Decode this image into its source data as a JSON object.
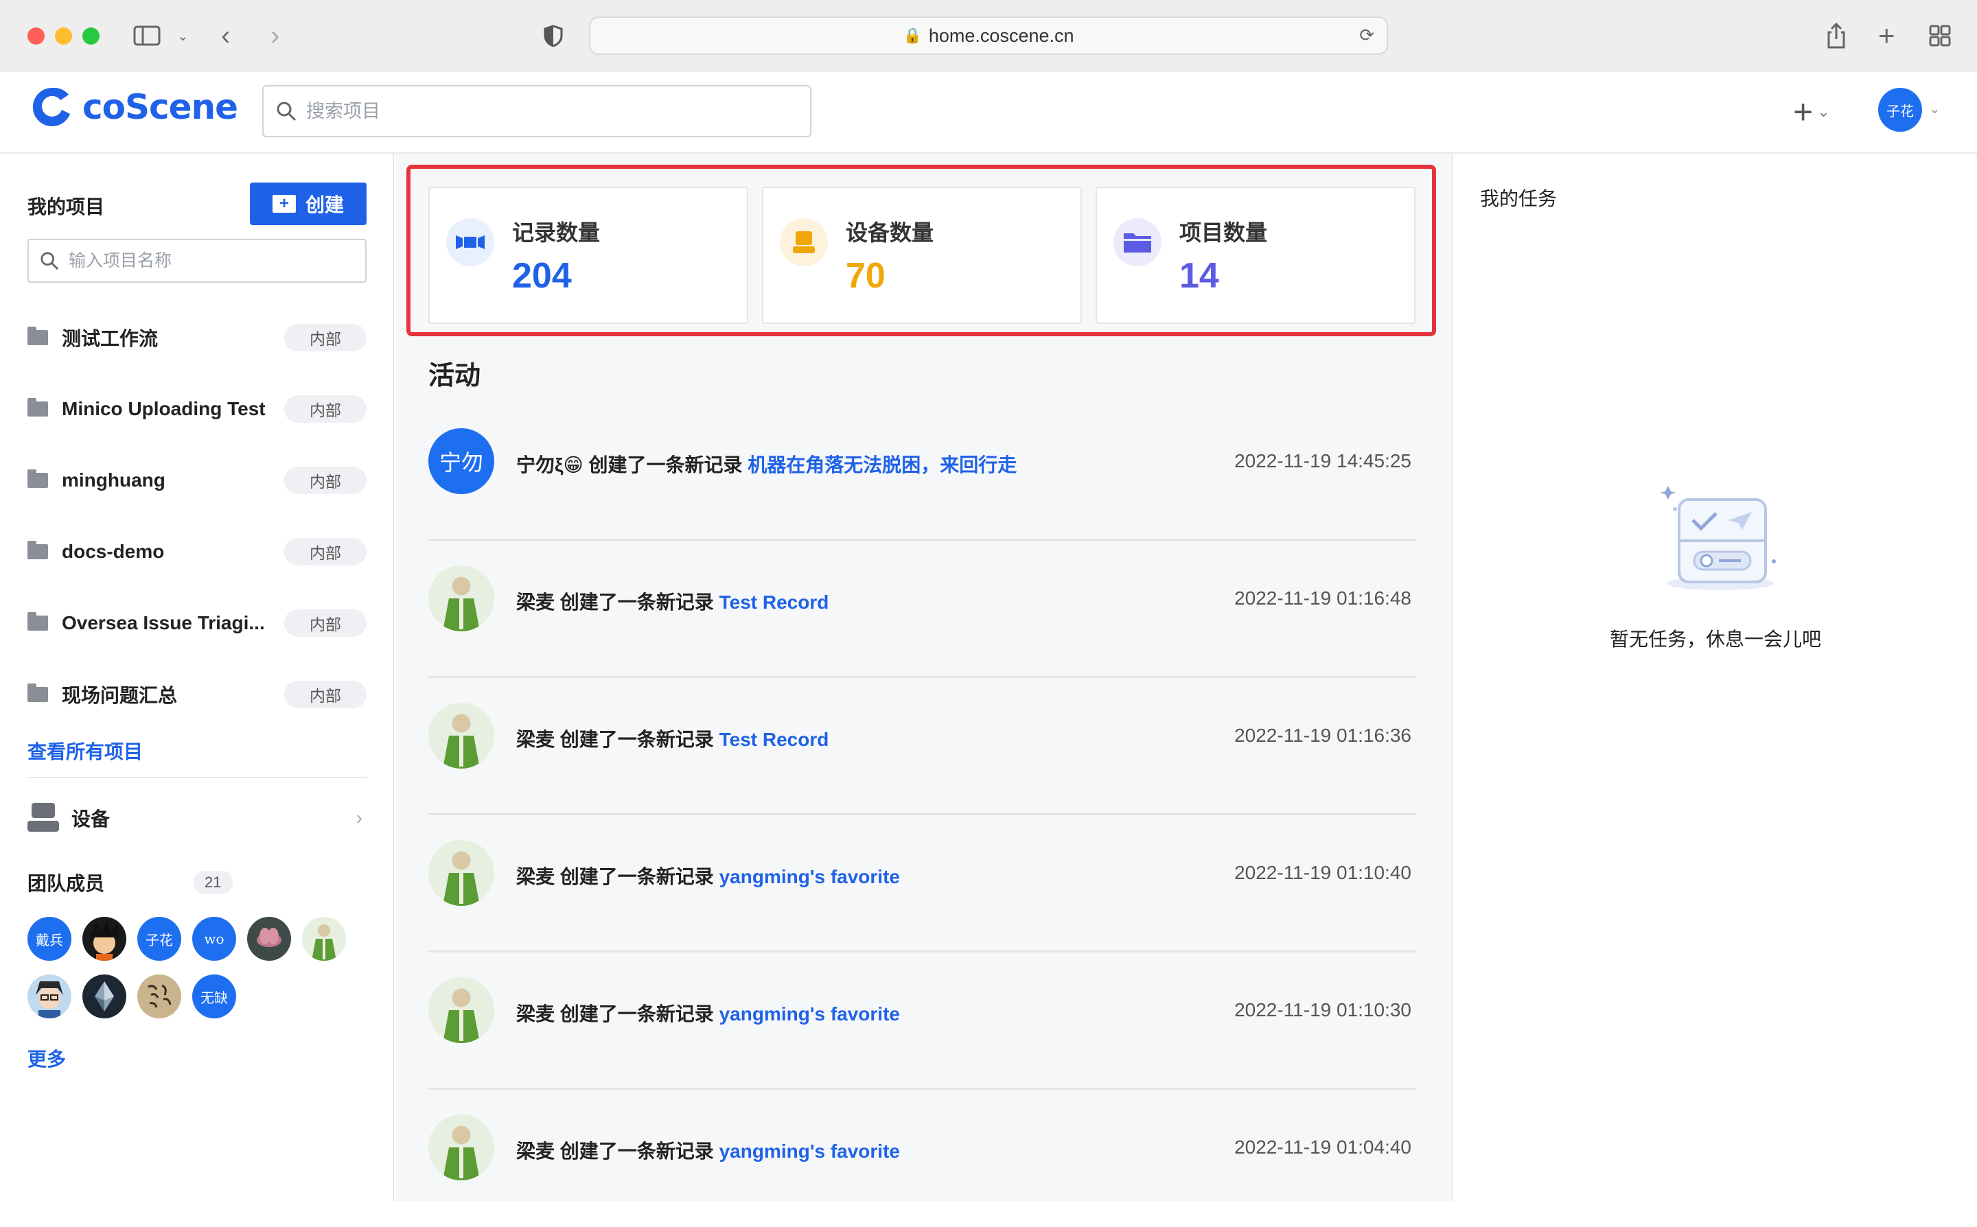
{
  "browser": {
    "url": "home.coscene.cn"
  },
  "header": {
    "logo_text": "coScene",
    "search_placeholder": "搜索项目",
    "user_avatar": "子花"
  },
  "sidebar": {
    "title": "我的项目",
    "create_label": "创建",
    "search_placeholder": "输入项目名称",
    "projects": [
      {
        "name": "测试工作流",
        "badge": "内部"
      },
      {
        "name": "Minico Uploading Test",
        "badge": "内部"
      },
      {
        "name": "minghuang",
        "badge": "内部"
      },
      {
        "name": "docs-demo",
        "badge": "内部"
      },
      {
        "name": "Oversea Issue Triagi...",
        "badge": "内部"
      },
      {
        "name": "现场问题汇总",
        "badge": "内部"
      }
    ],
    "view_all": "查看所有项目",
    "devices_label": "设备",
    "team_label": "团队成员",
    "team_count": "21",
    "members": [
      {
        "text": "戴兵",
        "kind": "text"
      },
      {
        "text": "",
        "kind": "cartoon"
      },
      {
        "text": "子花",
        "kind": "text"
      },
      {
        "text": "wo",
        "kind": "text"
      },
      {
        "text": "",
        "kind": "flower"
      },
      {
        "text": "",
        "kind": "green"
      },
      {
        "text": "",
        "kind": "anime"
      },
      {
        "text": "",
        "kind": "diamond"
      },
      {
        "text": "",
        "kind": "calligraphy"
      },
      {
        "text": "无缺",
        "kind": "text"
      }
    ],
    "more": "更多"
  },
  "stats": [
    {
      "label": "记录数量",
      "value": "204",
      "color": "#1f62e8",
      "icon": "record-icon"
    },
    {
      "label": "设备数量",
      "value": "70",
      "color": "#f0a70a",
      "icon": "device-icon"
    },
    {
      "label": "项目数量",
      "value": "14",
      "color": "#5b5ce2",
      "icon": "folder-icon"
    }
  ],
  "activity": {
    "title": "活动",
    "items": [
      {
        "user": "宁勿ξ😁",
        "avatar_text": "宁勿",
        "action": "创建了一条新记录",
        "target": "机器在角落无法脱困，来回行走",
        "time": "2022-11-19 14:45:25"
      },
      {
        "user": "梁麦",
        "avatar_text": "",
        "action": "创建了一条新记录",
        "target": "Test Record",
        "time": "2022-11-19 01:16:48"
      },
      {
        "user": "梁麦",
        "avatar_text": "",
        "action": "创建了一条新记录",
        "target": "Test Record",
        "time": "2022-11-19 01:16:36"
      },
      {
        "user": "梁麦",
        "avatar_text": "",
        "action": "创建了一条新记录",
        "target": "yangming's favorite",
        "time": "2022-11-19 01:10:40"
      },
      {
        "user": "梁麦",
        "avatar_text": "",
        "action": "创建了一条新记录",
        "target": "yangming's favorite",
        "time": "2022-11-19 01:10:30"
      },
      {
        "user": "梁麦",
        "avatar_text": "",
        "action": "创建了一条新记录",
        "target": "yangming's favorite",
        "time": "2022-11-19 01:04:40"
      }
    ]
  },
  "tasks": {
    "title": "我的任务",
    "empty_text": "暂无任务，休息一会儿吧"
  }
}
